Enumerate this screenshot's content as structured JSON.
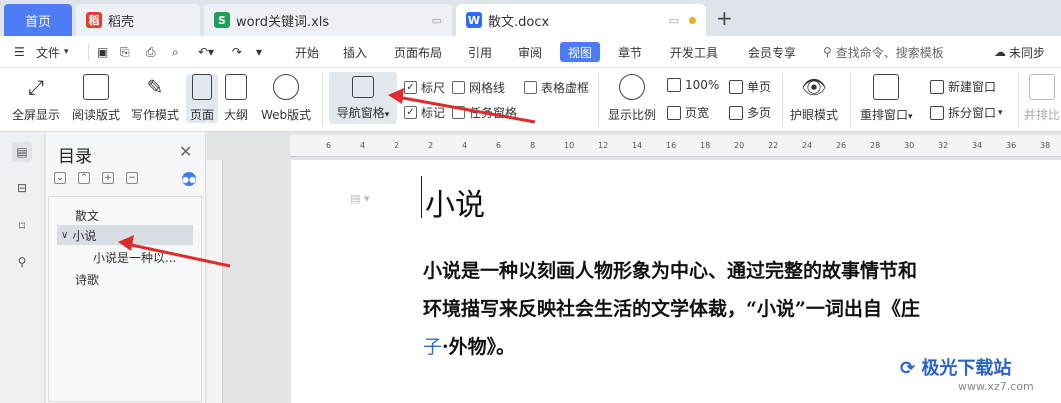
{
  "tabs": {
    "home": "首页",
    "daoke": "稻壳",
    "xls": "word关键词.xls",
    "active": "散文.docx"
  },
  "menu": {
    "file": "文件",
    "items": [
      "开始",
      "插入",
      "页面布局",
      "引用",
      "审阅",
      "视图",
      "章节",
      "开发工具",
      "会员专享"
    ],
    "search_placeholder": "查找命令、搜索模板",
    "sync": "未同步"
  },
  "ribbon": {
    "full_screen": "全屏显示",
    "reading": "阅读版式",
    "writing": "写作模式",
    "page": "页面",
    "outline": "大纲",
    "web": "Web版式",
    "nav_pane": "导航窗格",
    "ruler": "标尺",
    "gridlines": "网格线",
    "table_dashed": "表格虚框",
    "markers": "标记",
    "task_pane": "任务窗格",
    "zoom_ratio": "显示比例",
    "zoom_100": "100%",
    "single_page": "单页",
    "page_width": "页宽",
    "multi_page": "多页",
    "eye_mode": "护眼模式",
    "rearrange": "重排窗口",
    "new_window": "新建窗口",
    "split_window": "拆分窗口",
    "sync_scroll": "并排比"
  },
  "toc": {
    "title": "目录",
    "items": [
      "散文",
      "小说",
      "小说是一种以...",
      "诗歌"
    ]
  },
  "doc": {
    "heading": "小说",
    "para_line1": "小说是一种以刻画人物形象为中心、通过完整的故事情节和",
    "para_line2": "环境描写来反映社会生活的文学体裁，“小说”一词出自《庄",
    "para_line3a": "子",
    "para_line3b": "·外物》。"
  },
  "ruler_ticks": [
    "6",
    "4",
    "2",
    "2",
    "4",
    "6",
    "8",
    "10",
    "12",
    "14",
    "16",
    "18",
    "20",
    "22",
    "24",
    "26",
    "28",
    "30",
    "32",
    "34",
    "36",
    "38"
  ],
  "watermark": {
    "brand": "极光下载站",
    "url": "www.xz7.com"
  }
}
